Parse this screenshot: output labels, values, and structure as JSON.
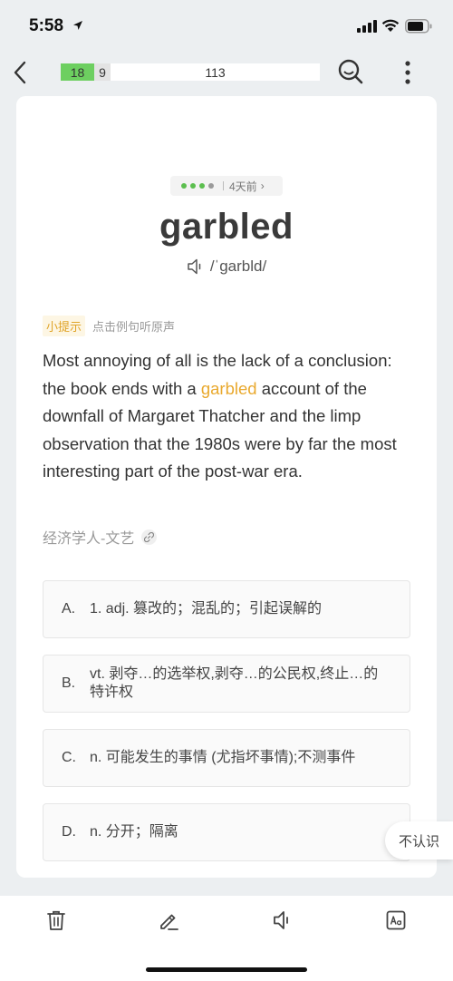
{
  "status": {
    "time": "5:58"
  },
  "progress": {
    "learned": "18",
    "review": "9",
    "remaining": "113"
  },
  "card": {
    "review_ago": "4天前",
    "word": "garbled",
    "phonetic": "/ˈgarbld/",
    "hint_tag": "小提示",
    "hint_text": "点击例句听原声",
    "sentence_before": "Most annoying of all is the lack of a conclusion: the book ends with a ",
    "sentence_highlight": "garbled",
    "sentence_after": " account of the downfall of Margaret Thatcher and the limp observation that the 1980s were by far the most interesting part of the post-war era.",
    "source": "经济学人-文艺"
  },
  "options": [
    {
      "letter": "A.",
      "text": "1. adj. 篡改的；混乱的；引起误解的"
    },
    {
      "letter": "B.",
      "text": "vt. 剥夺…的选举权,剥夺…的公民权,终止…的特许权"
    },
    {
      "letter": "C.",
      "text": "n. 可能发生的事情 (尤指坏事情);不测事件"
    },
    {
      "letter": "D.",
      "text": "n. 分开；隔离"
    }
  ],
  "unknown_label": "不认识",
  "colors": {
    "accent_green": "#6dcf60",
    "highlight": "#e9a92e"
  },
  "toolbar": {
    "icons": [
      "trash-icon",
      "edit-icon",
      "speaker-icon",
      "font-size-icon"
    ]
  }
}
